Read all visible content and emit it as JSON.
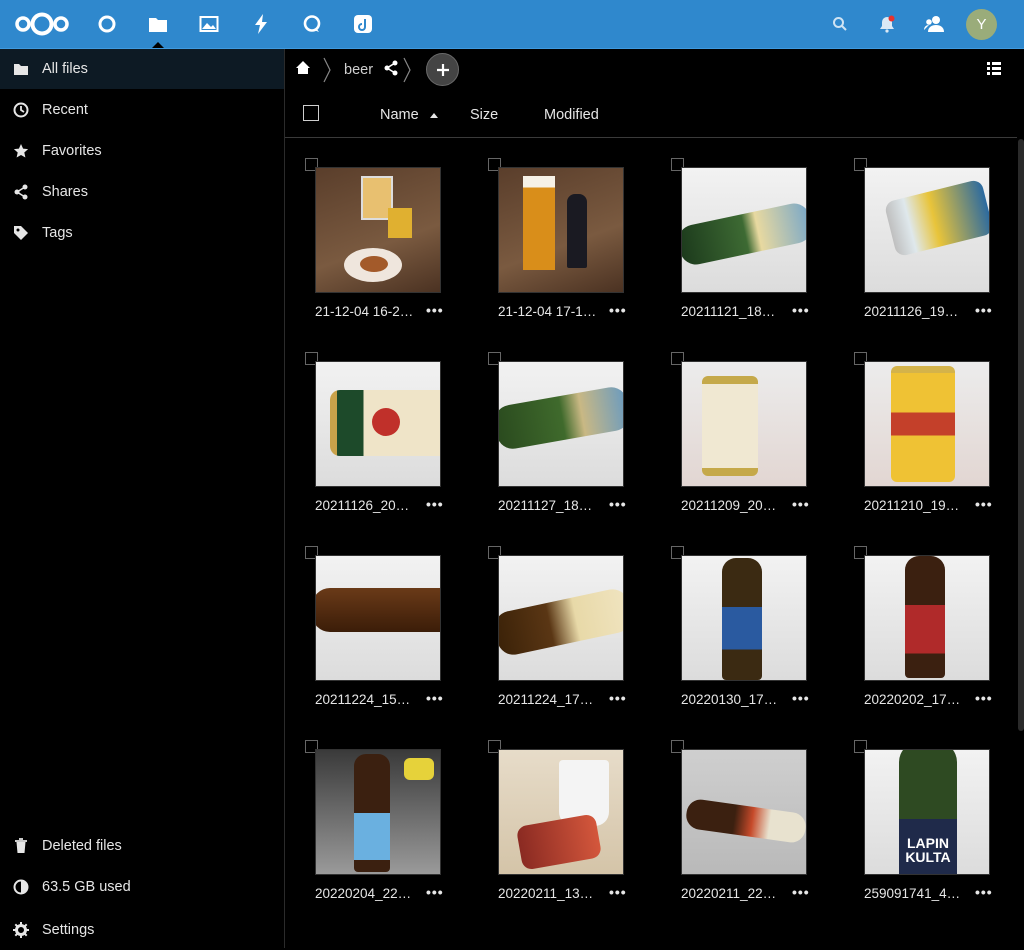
{
  "header": {
    "apps": [
      "logo-icon",
      "dashboard-icon",
      "files-icon",
      "photos-icon",
      "activity-icon",
      "talk-icon",
      "deck-icon"
    ],
    "avatar_initial": "Y",
    "accent": "#2f88cd"
  },
  "sidebar": {
    "items": [
      {
        "label": "All files",
        "icon": "folder-icon"
      },
      {
        "label": "Recent",
        "icon": "clock-icon"
      },
      {
        "label": "Favorites",
        "icon": "star-icon"
      },
      {
        "label": "Shares",
        "icon": "share-icon"
      },
      {
        "label": "Tags",
        "icon": "tag-icon"
      }
    ],
    "footer": [
      {
        "label": "Deleted files",
        "icon": "trash-icon"
      },
      {
        "label": "63.5 GB used",
        "icon": "pie-icon"
      },
      {
        "label": "Settings",
        "icon": "gear-icon"
      }
    ]
  },
  "breadcrumb": {
    "folder": "beer"
  },
  "columns": {
    "name": "Name",
    "size": "Size",
    "modified": "Modified"
  },
  "files": [
    {
      "name": "21-12-04 16-2…",
      "thumb": "table with beer glasses"
    },
    {
      "name": "21-12-04 17-1…",
      "thumb": "beer glass and bottle"
    },
    {
      "name": "20211121_18…",
      "thumb": "green bottle"
    },
    {
      "name": "20211126_19…",
      "thumb": "Belgian White can"
    },
    {
      "name": "20211126_20…",
      "thumb": "Pilsner Urquell bottle"
    },
    {
      "name": "20211127_18…",
      "thumb": "green bottle"
    },
    {
      "name": "20211209_20…",
      "thumb": "Asahi can"
    },
    {
      "name": "20211210_19…",
      "thumb": "Sapporo Ginza Lion can"
    },
    {
      "name": "20211224_15…",
      "thumb": "brown bottle"
    },
    {
      "name": "20211224_17…",
      "thumb": "brown bottle"
    },
    {
      "name": "20220130_17…",
      "thumb": "brown bottle blue label"
    },
    {
      "name": "20220202_17…",
      "thumb": "Yokohama Beer bottle"
    },
    {
      "name": "20220204_22…",
      "thumb": "bottle on keyboard"
    },
    {
      "name": "20220211_13…",
      "thumb": "red can with cup"
    },
    {
      "name": "20220211_22…",
      "thumb": "bottle lying"
    },
    {
      "name": "259091741_4…",
      "thumb": "Lapin Kulta bottle"
    }
  ],
  "more_label": "•••"
}
